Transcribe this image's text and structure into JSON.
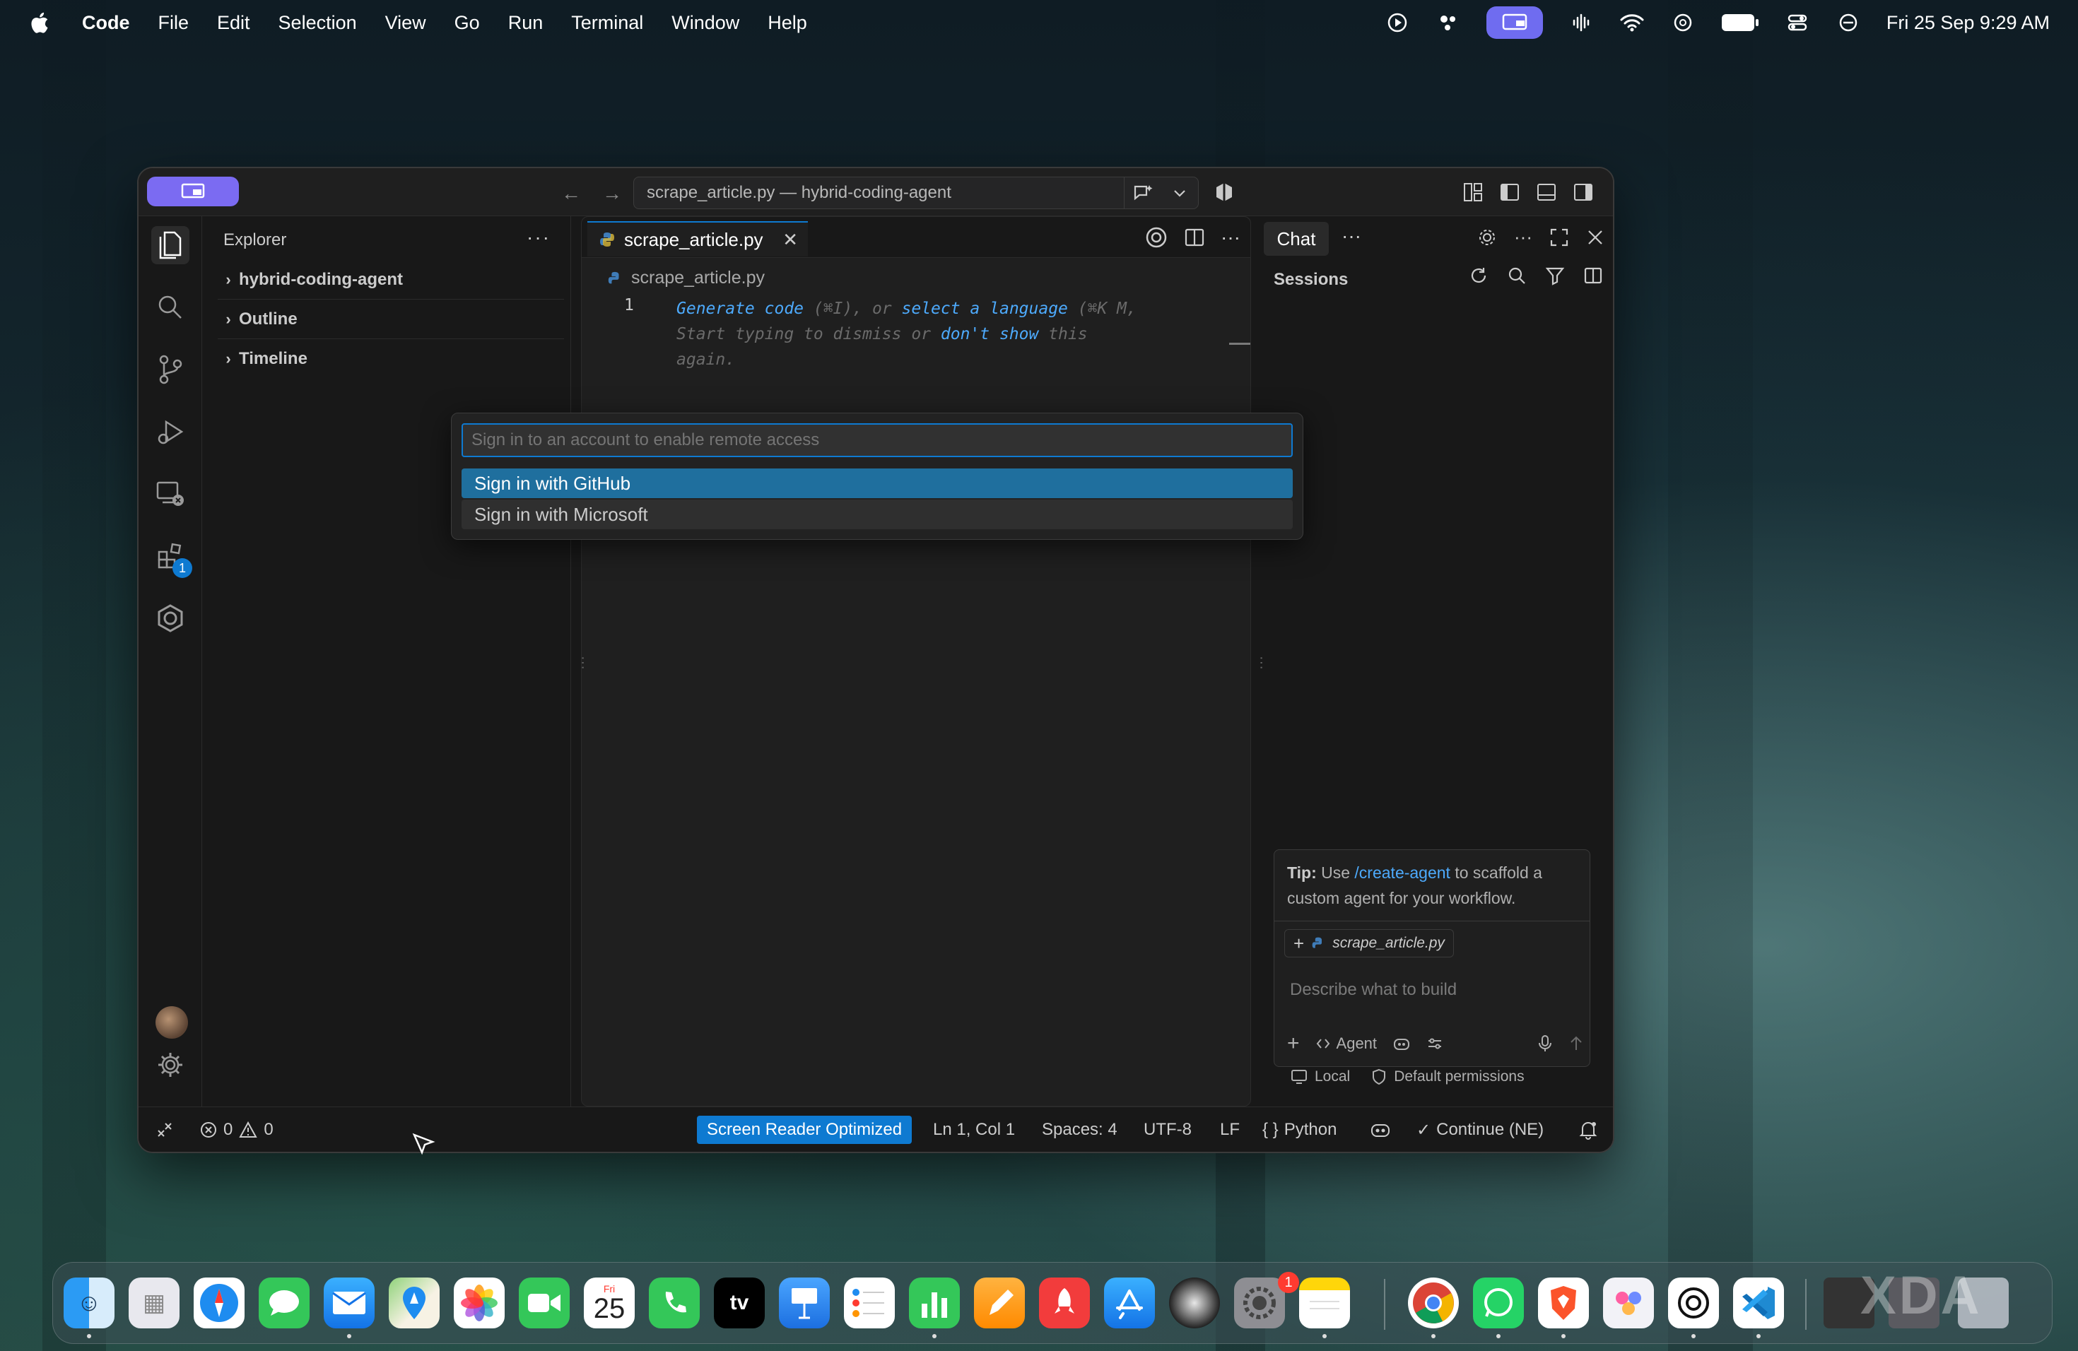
{
  "menubar": {
    "app_name": "Code",
    "menus": [
      "File",
      "Edit",
      "Selection",
      "View",
      "Go",
      "Run",
      "Terminal",
      "Window",
      "Help"
    ],
    "clock": "Fri 25 Sep  9:29 AM"
  },
  "titlebar": {
    "command_center": "scrape_article.py — hybrid-coding-agent"
  },
  "explorer": {
    "title": "Explorer",
    "sections": [
      {
        "label": "hybrid-coding-agent"
      },
      {
        "label": "Outline"
      },
      {
        "label": "Timeline"
      }
    ],
    "extensions_badge": "1"
  },
  "editor": {
    "tab_label": "scrape_article.py",
    "breadcrumb": "scrape_article.py",
    "line_number": "1",
    "hint": {
      "generate": "Generate code",
      "shortcut1": " (⌘I), or ",
      "select_language": "select a language",
      "shortcut2": " (⌘K M,",
      "start": "Start typing to dismiss or ",
      "dont_show": "don't show",
      "this": " this",
      "again": "again."
    }
  },
  "quickpick": {
    "placeholder": "Sign in to an account to enable remote access",
    "items": [
      "Sign in with GitHub",
      "Sign in with Microsoft"
    ]
  },
  "chat": {
    "tab_label": "Chat",
    "sessions_title": "Sessions",
    "tip_bold": "Tip:",
    "tip_pre": " Use ",
    "tip_cmd": "/create-agent",
    "tip_post": " to scaffold a custom agent for your workflow.",
    "context_file": "scrape_article.py",
    "input_placeholder": "Describe what to build",
    "mode": "Agent",
    "footer_local": "Local",
    "footer_permissions": "Default permissions"
  },
  "statusbar": {
    "errors": "0",
    "warnings": "0",
    "screen_reader": "Screen Reader Optimized",
    "position": "Ln 1, Col 1",
    "spaces": "Spaces: 4",
    "encoding": "UTF-8",
    "eol": "LF",
    "language": "Python",
    "continue": "Continue (NE)"
  },
  "dock": {
    "calendar_month": "Fri",
    "calendar_day": "25",
    "settings_badge": "1",
    "tv_label": "tv"
  },
  "watermark": "XDA",
  "colors": {
    "accent": "#0e7ad1",
    "remote_pill": "#7b6bf2",
    "selection": "#1f6f9e",
    "link": "#4daafc"
  }
}
